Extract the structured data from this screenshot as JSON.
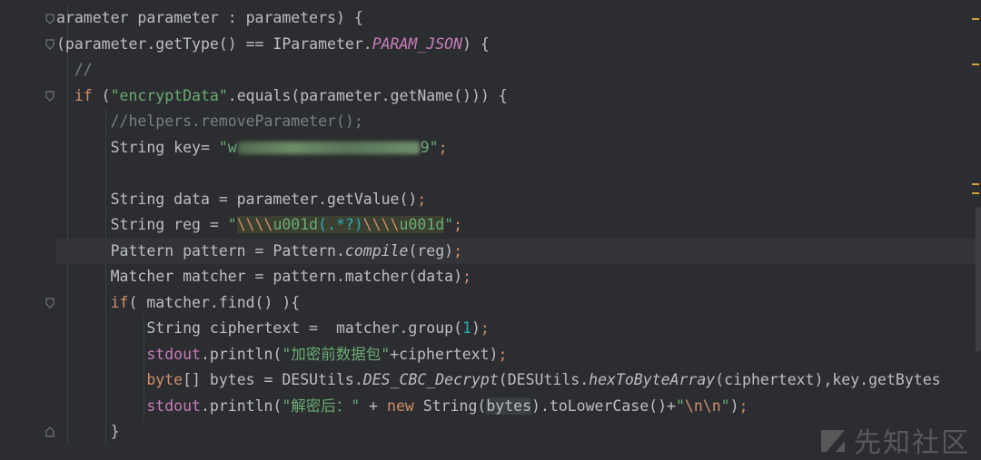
{
  "editor": {
    "theme": "dark",
    "colors": {
      "background": "#2b2d30",
      "keyword": "#cf8e6d",
      "string": "#6aab73",
      "number": "#2aacb8",
      "comment": "#7a7e85",
      "constant": "#c77dbb"
    }
  },
  "code": {
    "l1": "arameter parameter : parameters) {",
    "l2a": "(parameter.getType() == IParameter.",
    "l2b": "PARAM_JSON",
    "l2c": ") {",
    "l3": "//",
    "l4a": "if",
    "l4b": " (",
    "l4c": "\"encryptData\"",
    "l4d": ".equals(parameter.getName())) {",
    "l5": "//helpers.removeParameter();",
    "l6a": "String key= ",
    "l6b": "\"w",
    "l6c": "9\"",
    "l6d": ";",
    "l8a": "String data = parameter.getValue()",
    "l8b": ";",
    "l9a": "String reg = ",
    "l9b": "\"",
    "l9c": "\\\\\\\\",
    "l9d": "u001d",
    "l9e": "(.*?)",
    "l9f": "\\\\\\\\",
    "l9g": "u001d",
    "l9h": "\"",
    "l9i": ";",
    "l10a": "Pattern pattern = Pattern.",
    "l10b": "compile",
    "l10c": "(reg)",
    "l10d": ";",
    "l11a": "Matcher matcher = pattern.matcher(data)",
    "l11b": ";",
    "l12a": "if",
    "l12b": "( matcher.find() ){",
    "l13a": "String ciphertext =  matcher.group(",
    "l13b": "1",
    "l13c": ")",
    "l13d": ";",
    "l14a": "stdout",
    "l14b": ".println(",
    "l14c": "\"加密前数据包\"",
    "l14d": "+ciphertext)",
    "l14e": ";",
    "l15a": "byte",
    "l15b": "[] bytes = DESUtils.",
    "l15c": "DES_CBC_Decrypt",
    "l15d": "(DESUtils.",
    "l15e": "hexToByteArray",
    "l15f": "(ciphertext),key.getBytes",
    "l16a": "stdout",
    "l16b": ".println(",
    "l16c": "\"解密后：\"",
    "l16d": " + ",
    "l16e": "new",
    "l16f": " String(",
    "l16g": "bytes",
    "l16h": ").toLowerCase()+",
    "l16i": "\"",
    "l16j": "\\n\\n",
    "l16k": "\"",
    "l16l": ")",
    "l16m": ";",
    "l17": "}"
  },
  "watermark": {
    "text": "先知社区",
    "icon": "xianzhi-logo-icon"
  }
}
